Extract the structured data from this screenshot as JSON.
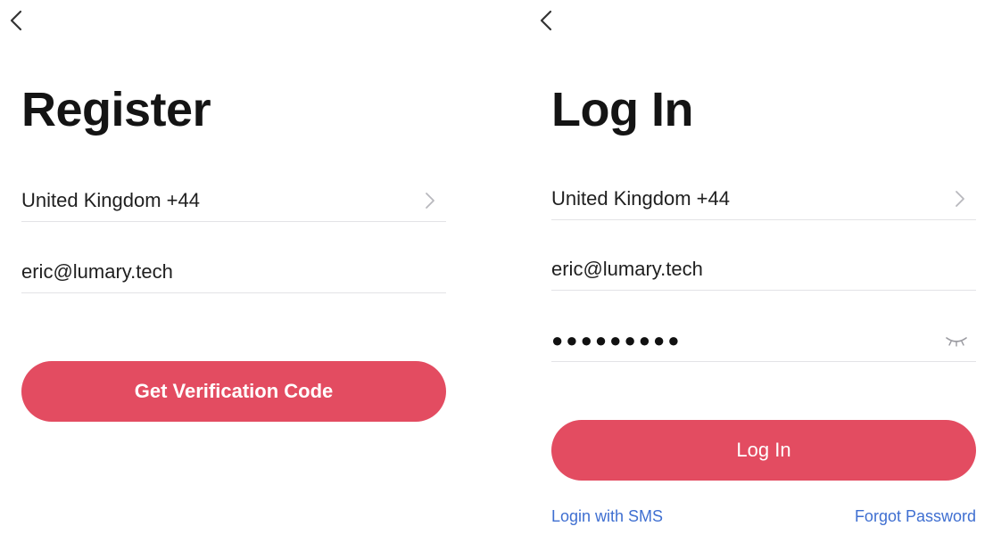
{
  "register": {
    "back_icon": "chevron-left-icon",
    "title": "Register",
    "country": {
      "value": "United Kingdom +44",
      "icon": "chevron-right-icon"
    },
    "email": {
      "value": "eric@lumary.tech"
    },
    "submit_label": "Get Verification Code"
  },
  "login": {
    "back_icon": "chevron-left-icon",
    "title": "Log In",
    "country": {
      "value": "United Kingdom +44",
      "icon": "chevron-right-icon"
    },
    "email": {
      "value": "eric@lumary.tech"
    },
    "password": {
      "masked": "●●●●●●●●●",
      "toggle_icon": "eye-closed-icon"
    },
    "submit_label": "Log In",
    "sms_link": "Login with SMS",
    "forgot_link": "Forgot Password"
  },
  "colors": {
    "accent": "#e34c61",
    "link": "#3f6fd1",
    "divider": "#e3e3e6"
  }
}
